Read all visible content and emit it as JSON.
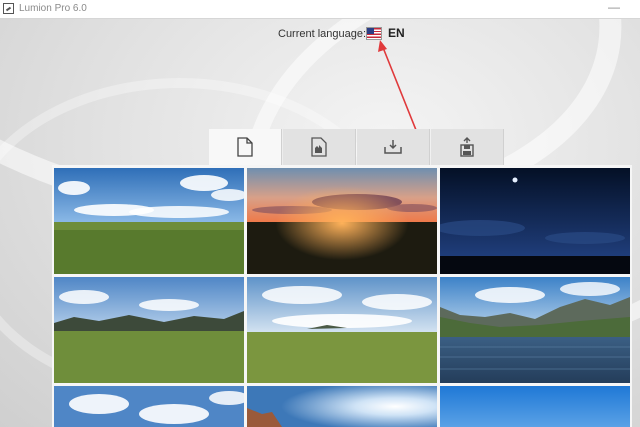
{
  "window": {
    "title": "Lumion Pro 6.0",
    "close_glyph": "—"
  },
  "language": {
    "label": "Current language:",
    "code": "EN",
    "flag_icon": "us-flag-icon"
  },
  "tabs": [
    {
      "icon": "new-scene-icon",
      "active": true
    },
    {
      "icon": "example-scene-icon",
      "active": false
    },
    {
      "icon": "load-scene-icon",
      "active": false
    },
    {
      "icon": "save-scene-icon",
      "active": false
    }
  ],
  "scenes": [
    {
      "preset": "grass-day-sky"
    },
    {
      "preset": "sunset"
    },
    {
      "preset": "night-sky"
    },
    {
      "preset": "grass-mountains"
    },
    {
      "preset": "grass-plain-clouds"
    },
    {
      "preset": "water-mountains"
    },
    {
      "preset": "cloud-sky-partial"
    },
    {
      "preset": "sun-glare-partial"
    },
    {
      "preset": "blue-sky-partial"
    }
  ],
  "colors": {
    "annotation_arrow": "#e0393b",
    "panel_bg": "#f6f6f6"
  }
}
